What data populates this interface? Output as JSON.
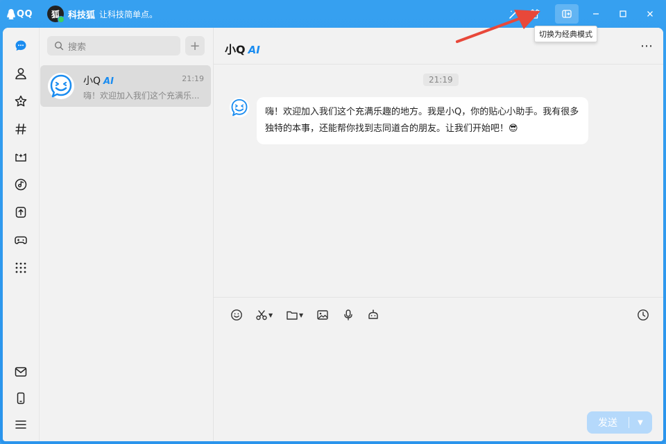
{
  "app": {
    "logo_text": "QQ"
  },
  "profile": {
    "avatar_text": "狐",
    "name": "科技狐",
    "signature": "让科技简单点。"
  },
  "tooltip": {
    "text": "切换为经典模式"
  },
  "search": {
    "placeholder": "搜索"
  },
  "conversations": [
    {
      "title": "小Q",
      "tag": "AI",
      "time": "21:19",
      "preview": "嗨！欢迎加入我们这个充满乐..."
    }
  ],
  "chat": {
    "title": "小Q",
    "tag": "AI",
    "timestamp": "21:19",
    "message": "嗨！欢迎加入我们这个充满乐趣的地方。我是小Q，你的贴心小助手。我有很多独特的本事，还能帮你找到志同道合的朋友。让我们开始吧！😎"
  },
  "composer": {
    "send_label": "发送"
  },
  "colors": {
    "accent": "#1a8cf0",
    "titlebar": "#2f9aee",
    "send_disabled": "#b5d9fb"
  }
}
